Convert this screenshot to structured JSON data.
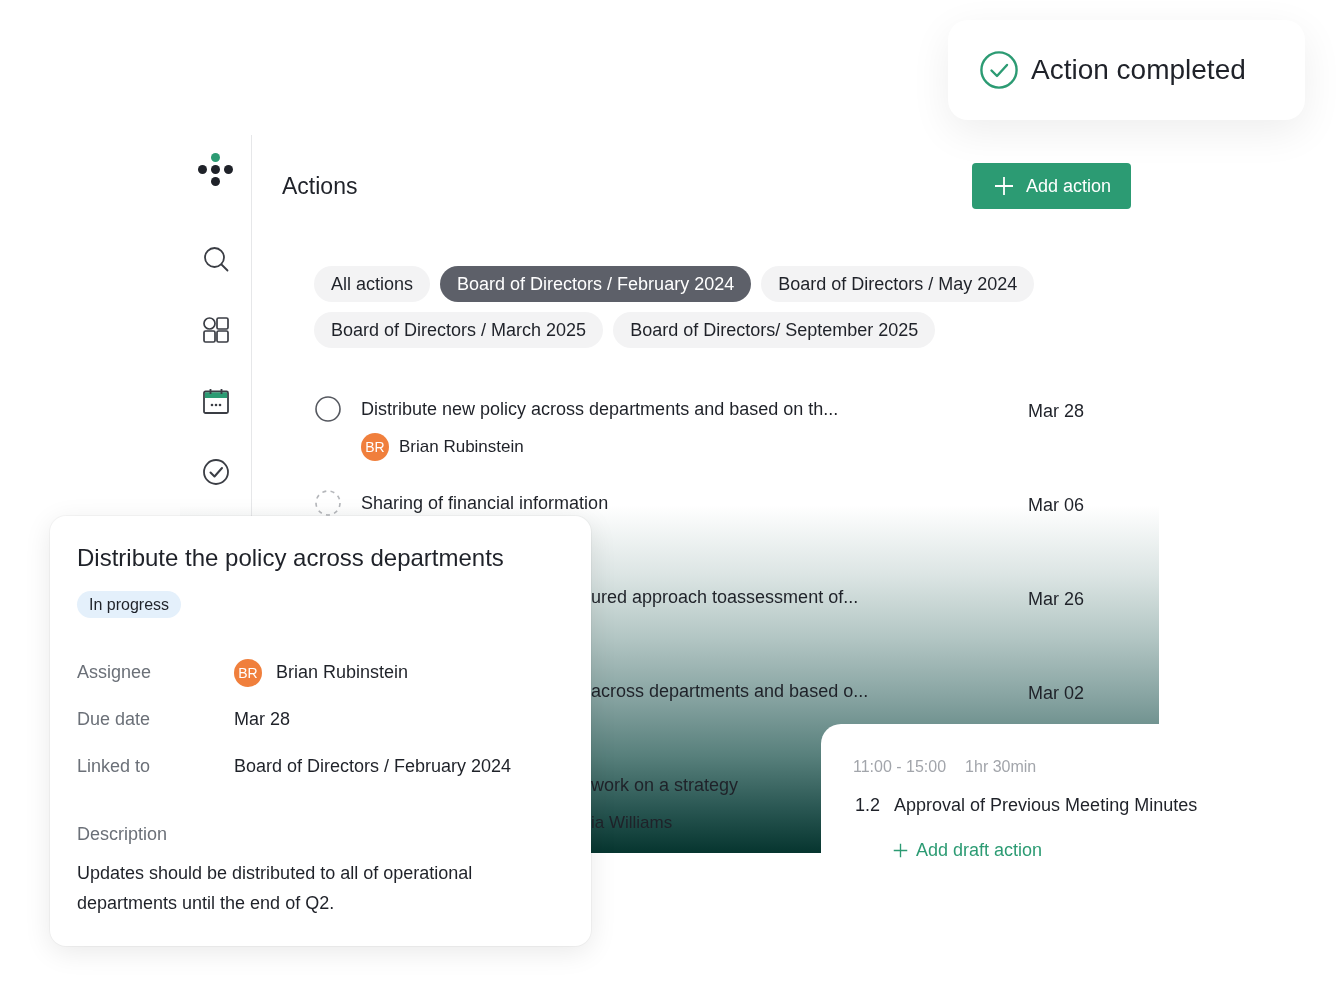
{
  "toast": {
    "message": "Action completed"
  },
  "header": {
    "title": "Actions",
    "add_button": "Add action"
  },
  "filters": [
    {
      "label": "All actions",
      "selected": false
    },
    {
      "label": "Board of Directors / February 2024",
      "selected": true
    },
    {
      "label": "Board of Directors / May 2024",
      "selected": false
    },
    {
      "label": "Board of Directors / March 2025",
      "selected": false
    },
    {
      "label": "Board of Directors/ September 2025",
      "selected": false
    }
  ],
  "actions": [
    {
      "kind": "full",
      "draft": false,
      "title": "Distribute new policy across departments and based on th...",
      "date": "Mar 28",
      "assignee": {
        "initials": "BR",
        "name": "Brian Rubinstein"
      }
    },
    {
      "kind": "full",
      "draft": true,
      "title": "Sharing of financial information",
      "date": "Mar 06"
    },
    {
      "kind": "clipped",
      "title": "ured approach toassessment of...",
      "date": "Mar 26"
    },
    {
      "kind": "clipped",
      "title": "across departments and based o...",
      "date": "Mar 02"
    },
    {
      "kind": "clipped",
      "title": "work on a strategy",
      "assignee": {
        "name": "ia Williams"
      }
    }
  ],
  "detail": {
    "title": "Distribute the policy across departments",
    "status": "In progress",
    "fields": [
      {
        "label": "Assignee",
        "initials": "BR",
        "value": "Brian Rubinstein"
      },
      {
        "label": "Due date",
        "value": "Mar 28"
      },
      {
        "label": "Linked to",
        "value": "Board of Directors / February 2024"
      }
    ],
    "description_label": "Description",
    "description": "Updates should be distributed to all of operational departments until the end of Q2."
  },
  "meeting": {
    "time": "11:00 - 15:00",
    "duration": "1hr 30min",
    "number": "1.2",
    "title": "Approval of Previous Meeting Minutes",
    "add_button": "Add draft action"
  }
}
